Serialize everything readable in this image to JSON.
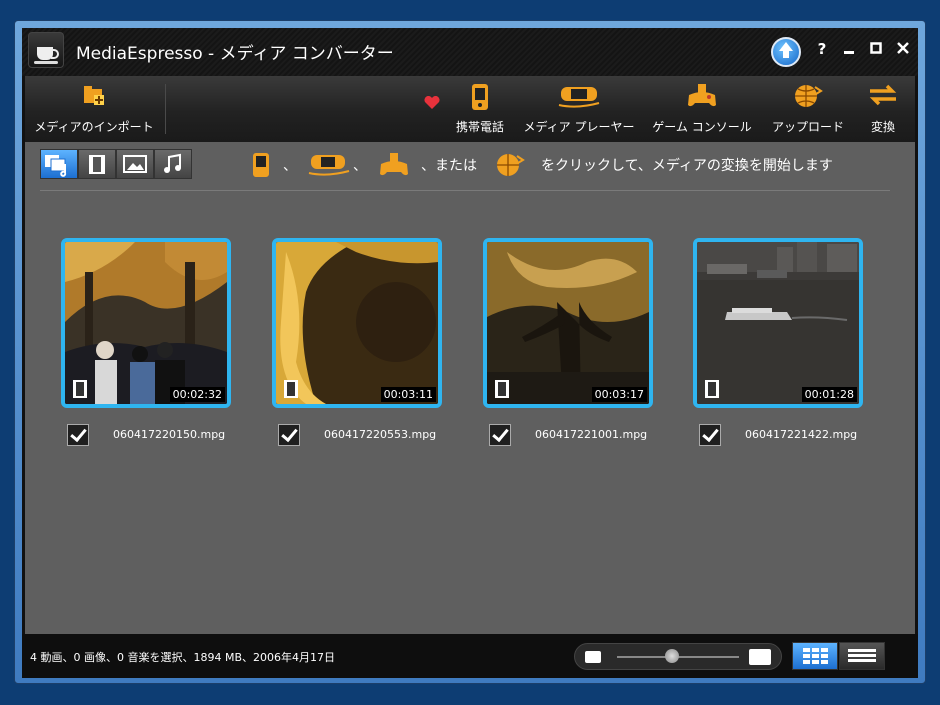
{
  "window": {
    "title": "MediaEspresso  - メディア コンバーター",
    "help_label": "?",
    "colors": {
      "accent": "#2fb5f0",
      "icon_orange": "#f0a020"
    }
  },
  "toolbar": {
    "import_label": "メディアのインポート",
    "mobile_label": "携帯電話",
    "player_label": "メディア プレーヤー",
    "console_label": "ゲーム コンソール",
    "upload_label": "アップロード",
    "convert_label": "変換"
  },
  "hint": {
    "sep1": "、",
    "sep2": "、",
    "or": "、または",
    "text": "をクリックして、メディアの変換を開始します"
  },
  "media": [
    {
      "filename": "060417220150.mpg",
      "duration": "00:02:32",
      "checked": true
    },
    {
      "filename": "060417220553.mpg",
      "duration": "00:03:11",
      "checked": true
    },
    {
      "filename": "060417221001.mpg",
      "duration": "00:03:17",
      "checked": true
    },
    {
      "filename": "060417221422.mpg",
      "duration": "00:01:28",
      "checked": true
    }
  ],
  "status": {
    "summary": "4 動画、0 画像、0 音楽を選択、1894 MB、2006年4月17日",
    "zoom_level": 0.45
  }
}
